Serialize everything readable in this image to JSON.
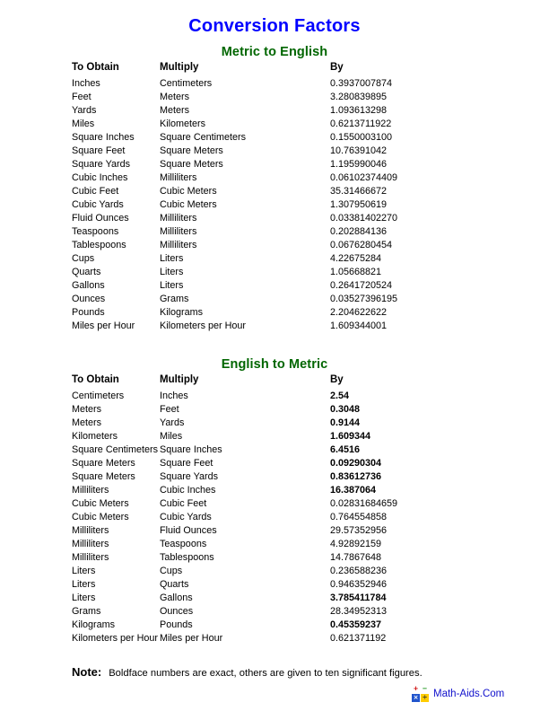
{
  "document": {
    "title": "Conversion Factors"
  },
  "columns": {
    "obtain": "To Obtain",
    "multiply": "Multiply",
    "by": "By"
  },
  "sections": [
    {
      "heading": "Metric to English",
      "rows": [
        {
          "obtain": "Inches",
          "multiply": "Centimeters",
          "by": "0.3937007874",
          "exact": false
        },
        {
          "obtain": "Feet",
          "multiply": "Meters",
          "by": "3.280839895",
          "exact": false
        },
        {
          "obtain": "Yards",
          "multiply": "Meters",
          "by": "1.093613298",
          "exact": false
        },
        {
          "obtain": "Miles",
          "multiply": "Kilometers",
          "by": "0.6213711922",
          "exact": false
        },
        {
          "obtain": "Square Inches",
          "multiply": "Square Centimeters",
          "by": "0.1550003100",
          "exact": false
        },
        {
          "obtain": "Square Feet",
          "multiply": "Square Meters",
          "by": "10.76391042",
          "exact": false
        },
        {
          "obtain": "Square Yards",
          "multiply": "Square Meters",
          "by": "1.195990046",
          "exact": false
        },
        {
          "obtain": "Cubic Inches",
          "multiply": "Milliliters",
          "by": "0.06102374409",
          "exact": false
        },
        {
          "obtain": "Cubic Feet",
          "multiply": "Cubic Meters",
          "by": "35.31466672",
          "exact": false
        },
        {
          "obtain": "Cubic Yards",
          "multiply": "Cubic Meters",
          "by": "1.307950619",
          "exact": false
        },
        {
          "obtain": "Fluid Ounces",
          "multiply": "Milliliters",
          "by": "0.03381402270",
          "exact": false
        },
        {
          "obtain": "Teaspoons",
          "multiply": "Milliliters",
          "by": "0.202884136",
          "exact": false
        },
        {
          "obtain": "Tablespoons",
          "multiply": "Milliliters",
          "by": "0.0676280454",
          "exact": false
        },
        {
          "obtain": "Cups",
          "multiply": "Liters",
          "by": "4.22675284",
          "exact": false
        },
        {
          "obtain": "Quarts",
          "multiply": "Liters",
          "by": "1.05668821",
          "exact": false
        },
        {
          "obtain": "Gallons",
          "multiply": "Liters",
          "by": "0.2641720524",
          "exact": false
        },
        {
          "obtain": "Ounces",
          "multiply": "Grams",
          "by": "0.03527396195",
          "exact": false
        },
        {
          "obtain": "Pounds",
          "multiply": "Kilograms",
          "by": "2.204622622",
          "exact": false
        },
        {
          "obtain": "Miles per Hour",
          "multiply": "Kilometers per Hour",
          "by": "1.609344001",
          "exact": false
        }
      ]
    },
    {
      "heading": "English to Metric",
      "rows": [
        {
          "obtain": "Centimeters",
          "multiply": "Inches",
          "by": "2.54",
          "exact": true
        },
        {
          "obtain": "Meters",
          "multiply": "Feet",
          "by": "0.3048",
          "exact": true
        },
        {
          "obtain": "Meters",
          "multiply": "Yards",
          "by": "0.9144",
          "exact": true
        },
        {
          "obtain": "Kilometers",
          "multiply": "Miles",
          "by": "1.609344",
          "exact": true
        },
        {
          "obtain": "Square Centimeters",
          "multiply": "Square Inches",
          "by": "6.4516",
          "exact": true
        },
        {
          "obtain": "Square Meters",
          "multiply": "Square Feet",
          "by": "0.09290304",
          "exact": true
        },
        {
          "obtain": "Square Meters",
          "multiply": "Square Yards",
          "by": "0.83612736",
          "exact": true
        },
        {
          "obtain": "Milliliters",
          "multiply": "Cubic Inches",
          "by": "16.387064",
          "exact": true
        },
        {
          "obtain": "Cubic Meters",
          "multiply": "Cubic Feet",
          "by": "0.02831684659",
          "exact": false
        },
        {
          "obtain": "Cubic Meters",
          "multiply": "Cubic Yards",
          "by": "0.764554858",
          "exact": false
        },
        {
          "obtain": "Milliliters",
          "multiply": "Fluid Ounces",
          "by": "29.57352956",
          "exact": false
        },
        {
          "obtain": "Milliliters",
          "multiply": "Teaspoons",
          "by": "4.92892159",
          "exact": false
        },
        {
          "obtain": "Milliliters",
          "multiply": "Tablespoons",
          "by": "14.7867648",
          "exact": false
        },
        {
          "obtain": "Liters",
          "multiply": "Cups",
          "by": "0.236588236",
          "exact": false
        },
        {
          "obtain": "Liters",
          "multiply": "Quarts",
          "by": "0.946352946",
          "exact": false
        },
        {
          "obtain": "Liters",
          "multiply": "Gallons",
          "by": "3.785411784",
          "exact": true
        },
        {
          "obtain": "Grams",
          "multiply": "Ounces",
          "by": "28.34952313",
          "exact": false
        },
        {
          "obtain": "Kilograms",
          "multiply": "Pounds",
          "by": "0.45359237",
          "exact": true
        },
        {
          "obtain": "Kilometers per Hour",
          "multiply": "Miles per Hour",
          "by": "0.621371192",
          "exact": false
        }
      ]
    }
  ],
  "note": {
    "label": "Note:",
    "text": "Boldface numbers are exact, others are given to ten significant figures."
  },
  "footer": {
    "brand": "Math-Aids.Com",
    "logo_tiles": [
      "+",
      "−",
      "×",
      "÷"
    ]
  },
  "colors": {
    "title": "#0000ff",
    "section_heading": "#006600",
    "brand": "#1111cc",
    "text": "#000000"
  }
}
